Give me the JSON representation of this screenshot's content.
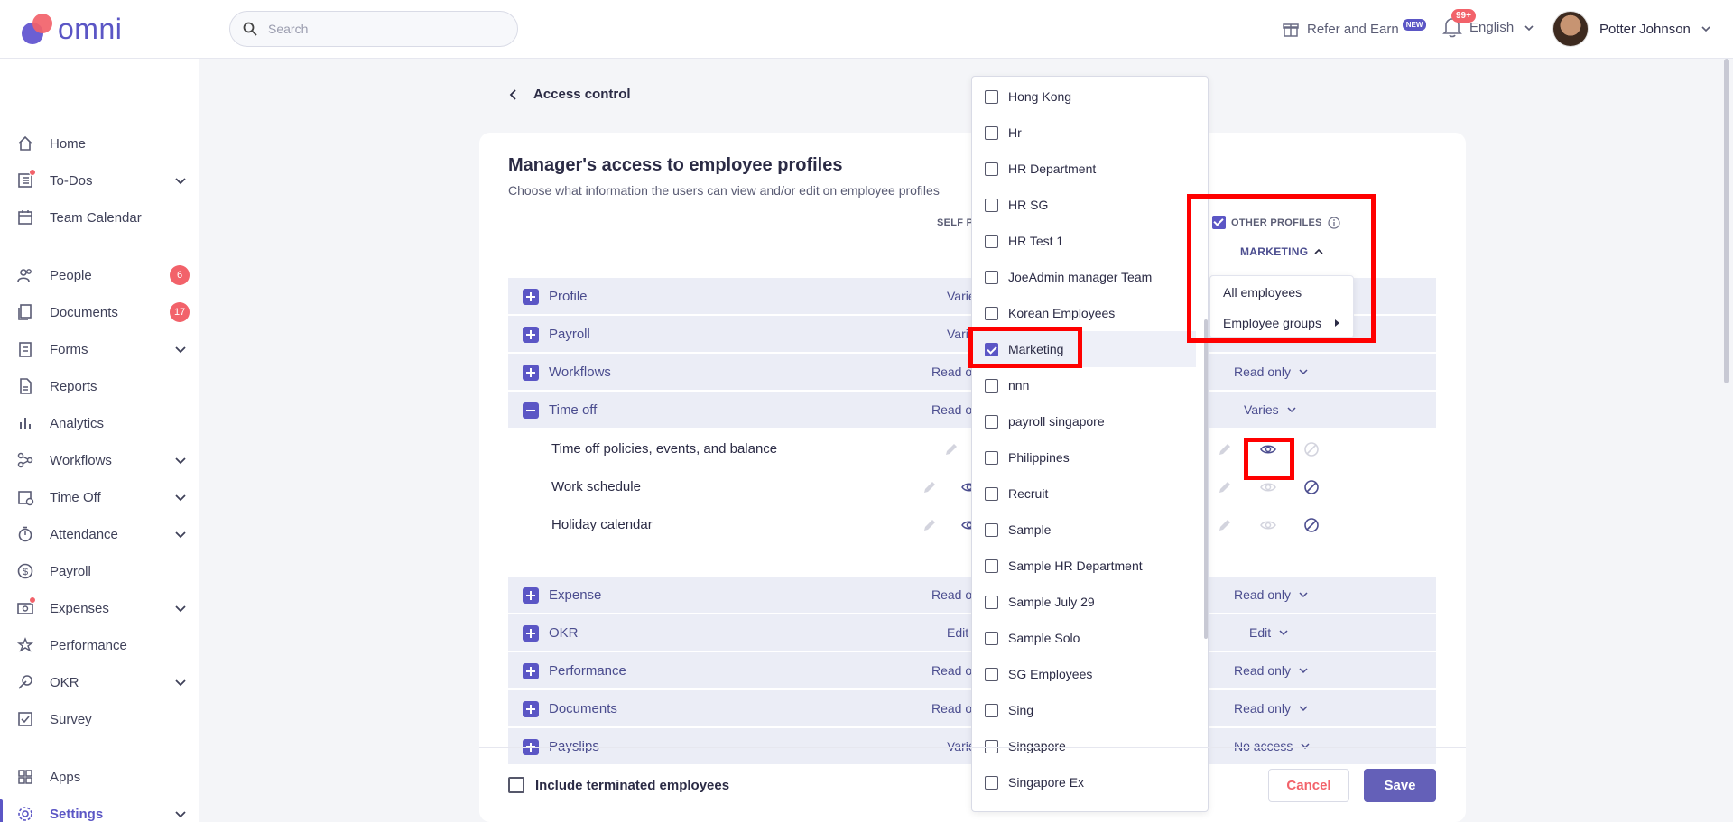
{
  "brand": {
    "name": "omni"
  },
  "search": {
    "placeholder": "Search"
  },
  "header": {
    "refer_label": "Refer and Earn",
    "new_badge": "NEW",
    "notifications_badge": "99+",
    "language": "English",
    "user_name": "Potter Johnson"
  },
  "sidebar": {
    "items": [
      {
        "label": "Home",
        "icon": "home-icon"
      },
      {
        "label": "To-Dos",
        "icon": "checklist-icon"
      },
      {
        "label": "Team Calendar",
        "icon": "calendar-icon"
      },
      {
        "label": "People",
        "icon": "people-icon",
        "count": "6"
      },
      {
        "label": "Documents",
        "icon": "documents-icon",
        "count": "17"
      },
      {
        "label": "Forms",
        "icon": "forms-icon"
      },
      {
        "label": "Reports",
        "icon": "reports-icon"
      },
      {
        "label": "Analytics",
        "icon": "analytics-icon"
      },
      {
        "label": "Workflows",
        "icon": "workflows-icon"
      },
      {
        "label": "Time Off",
        "icon": "time-off-icon"
      },
      {
        "label": "Attendance",
        "icon": "stopwatch-icon"
      },
      {
        "label": "Payroll",
        "icon": "dollar-icon"
      },
      {
        "label": "Expenses",
        "icon": "expenses-icon"
      },
      {
        "label": "Performance",
        "icon": "performance-icon"
      },
      {
        "label": "OKR",
        "icon": "okr-icon"
      },
      {
        "label": "Survey",
        "icon": "survey-icon"
      },
      {
        "label": "Apps",
        "icon": "apps-icon"
      },
      {
        "label": "Settings",
        "icon": "settings-icon"
      }
    ]
  },
  "page": {
    "back_label": "Access control",
    "title": "Manager's access to employee profiles",
    "subtitle": "Choose what information the users can view and/or edit on employee profiles",
    "self_col": "SELF P",
    "other_col": "OTHER PROFILES",
    "group_selected": "MARKETING",
    "submenu": [
      "All employees",
      "Employee groups"
    ]
  },
  "rows": [
    {
      "label": "Profile",
      "self": "Varie",
      "other": ""
    },
    {
      "label": "Payroll",
      "self": "Varie",
      "other": ""
    },
    {
      "label": "Workflows",
      "self": "Read or",
      "other": "Read only"
    },
    {
      "label": "Time off",
      "self": "Read or",
      "other": "Varies"
    },
    {
      "label": "Expense",
      "self": "Read or",
      "other": "Read only"
    },
    {
      "label": "OKR",
      "self": "Edit",
      "other": "Edit"
    },
    {
      "label": "Performance",
      "self": "Read or",
      "other": "Read only"
    },
    {
      "label": "Documents",
      "self": "Read or",
      "other": "Read only"
    },
    {
      "label": "Payslips",
      "self": "Varie",
      "other": "No access"
    }
  ],
  "subrows": [
    {
      "label": "Time off policies, events, and balance"
    },
    {
      "label": "Work schedule"
    },
    {
      "label": "Holiday calendar"
    }
  ],
  "groups": [
    "Hong Kong",
    "Hr",
    "HR Department",
    "HR SG",
    "HR Test 1",
    "JoeAdmin manager Team",
    "Korean Employees",
    "Marketing",
    "nnn",
    "payroll singapore",
    "Philippines",
    "Recruit",
    "Sample",
    "Sample HR Department",
    "Sample July 29",
    "Sample Solo",
    "SG Employees",
    "Sing",
    "Singapore",
    "Singapore Ex"
  ],
  "groups_checked": "Marketing",
  "footer": {
    "terminated_label": "Include terminated employees",
    "cancel_label": "Cancel",
    "save_label": "Save"
  },
  "colors": {
    "accent": "#5b56c5",
    "danger": "#f2626a",
    "annotation": "#ff0000"
  }
}
